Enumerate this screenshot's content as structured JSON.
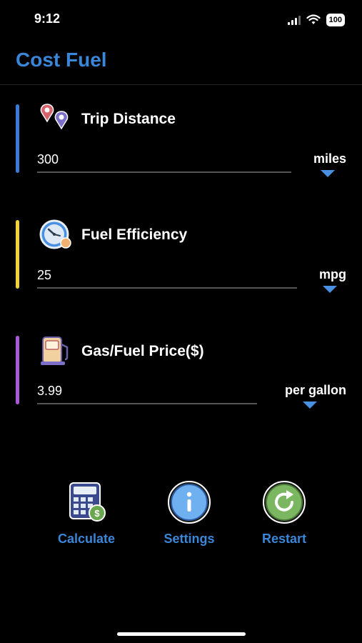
{
  "status_bar": {
    "time": "9:12",
    "battery": "100"
  },
  "app": {
    "title": "Cost Fuel"
  },
  "fields": {
    "trip_distance": {
      "label": "Trip Distance",
      "value": "300",
      "unit": "miles",
      "accent": "#3a7bd5",
      "icon": "map-pin-icon"
    },
    "fuel_efficiency": {
      "label": "Fuel Efficiency",
      "value": "25",
      "unit": "mpg",
      "accent": "#f2d13a",
      "icon": "gauge-icon"
    },
    "fuel_price": {
      "label": "Gas/Fuel Price($)",
      "value": "3.99",
      "unit": "per gallon",
      "accent": "#a85ad8",
      "icon": "gas-pump-icon"
    }
  },
  "actions": {
    "calculate": {
      "label": "Calculate",
      "icon": "calculator-icon"
    },
    "settings": {
      "label": "Settings",
      "icon": "info-icon"
    },
    "restart": {
      "label": "Restart",
      "icon": "refresh-icon"
    }
  }
}
